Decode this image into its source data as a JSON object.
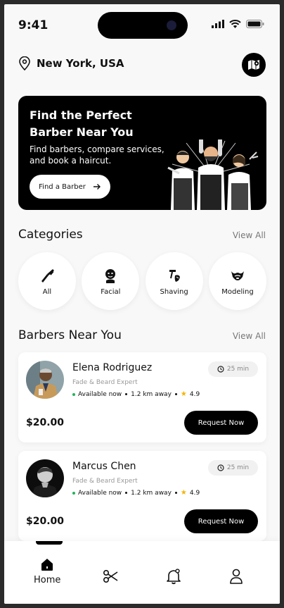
{
  "status_bar": {
    "time": "9:41"
  },
  "location": {
    "city": "New York, USA"
  },
  "hero": {
    "title": "Find the Perfect Barber Near You",
    "subtitle": "Find barbers, compare services, and book a haircut.",
    "button_label": "Find a Barber"
  },
  "categories": {
    "title": "Categories",
    "view_all": "View All",
    "items": [
      {
        "label": "All",
        "icon": "razor-icon"
      },
      {
        "label": "Facial",
        "icon": "face-mask-icon"
      },
      {
        "label": "Shaving",
        "icon": "shaving-icon"
      },
      {
        "label": "Modeling",
        "icon": "beard-icon"
      }
    ]
  },
  "barbers": {
    "title": "Barbers Near You",
    "view_all": "View All",
    "items": [
      {
        "name": "Elena Rodriguez",
        "specialty": "Fade & Beard Expert",
        "availability": "Available now",
        "distance": "1.2 km away",
        "rating": "4.9",
        "eta": "25 min",
        "price": "$20.00",
        "button": "Request Now"
      },
      {
        "name": "Marcus Chen",
        "specialty": "Fade & Beard Expert",
        "availability": "Available now",
        "distance": "1.2 km away",
        "rating": "4.9",
        "eta": "25 min",
        "price": "$20.00",
        "button": "Request Now"
      }
    ]
  },
  "tabbar": {
    "items": [
      {
        "label": "Home",
        "icon": "home-icon",
        "active": true
      },
      {
        "icon": "scissors-icon"
      },
      {
        "icon": "bell-icon"
      },
      {
        "icon": "profile-icon"
      }
    ]
  },
  "colors": {
    "accent": "#000000",
    "available": "#1fb45a",
    "star": "#f5b400",
    "background": "#f8f8f8"
  }
}
